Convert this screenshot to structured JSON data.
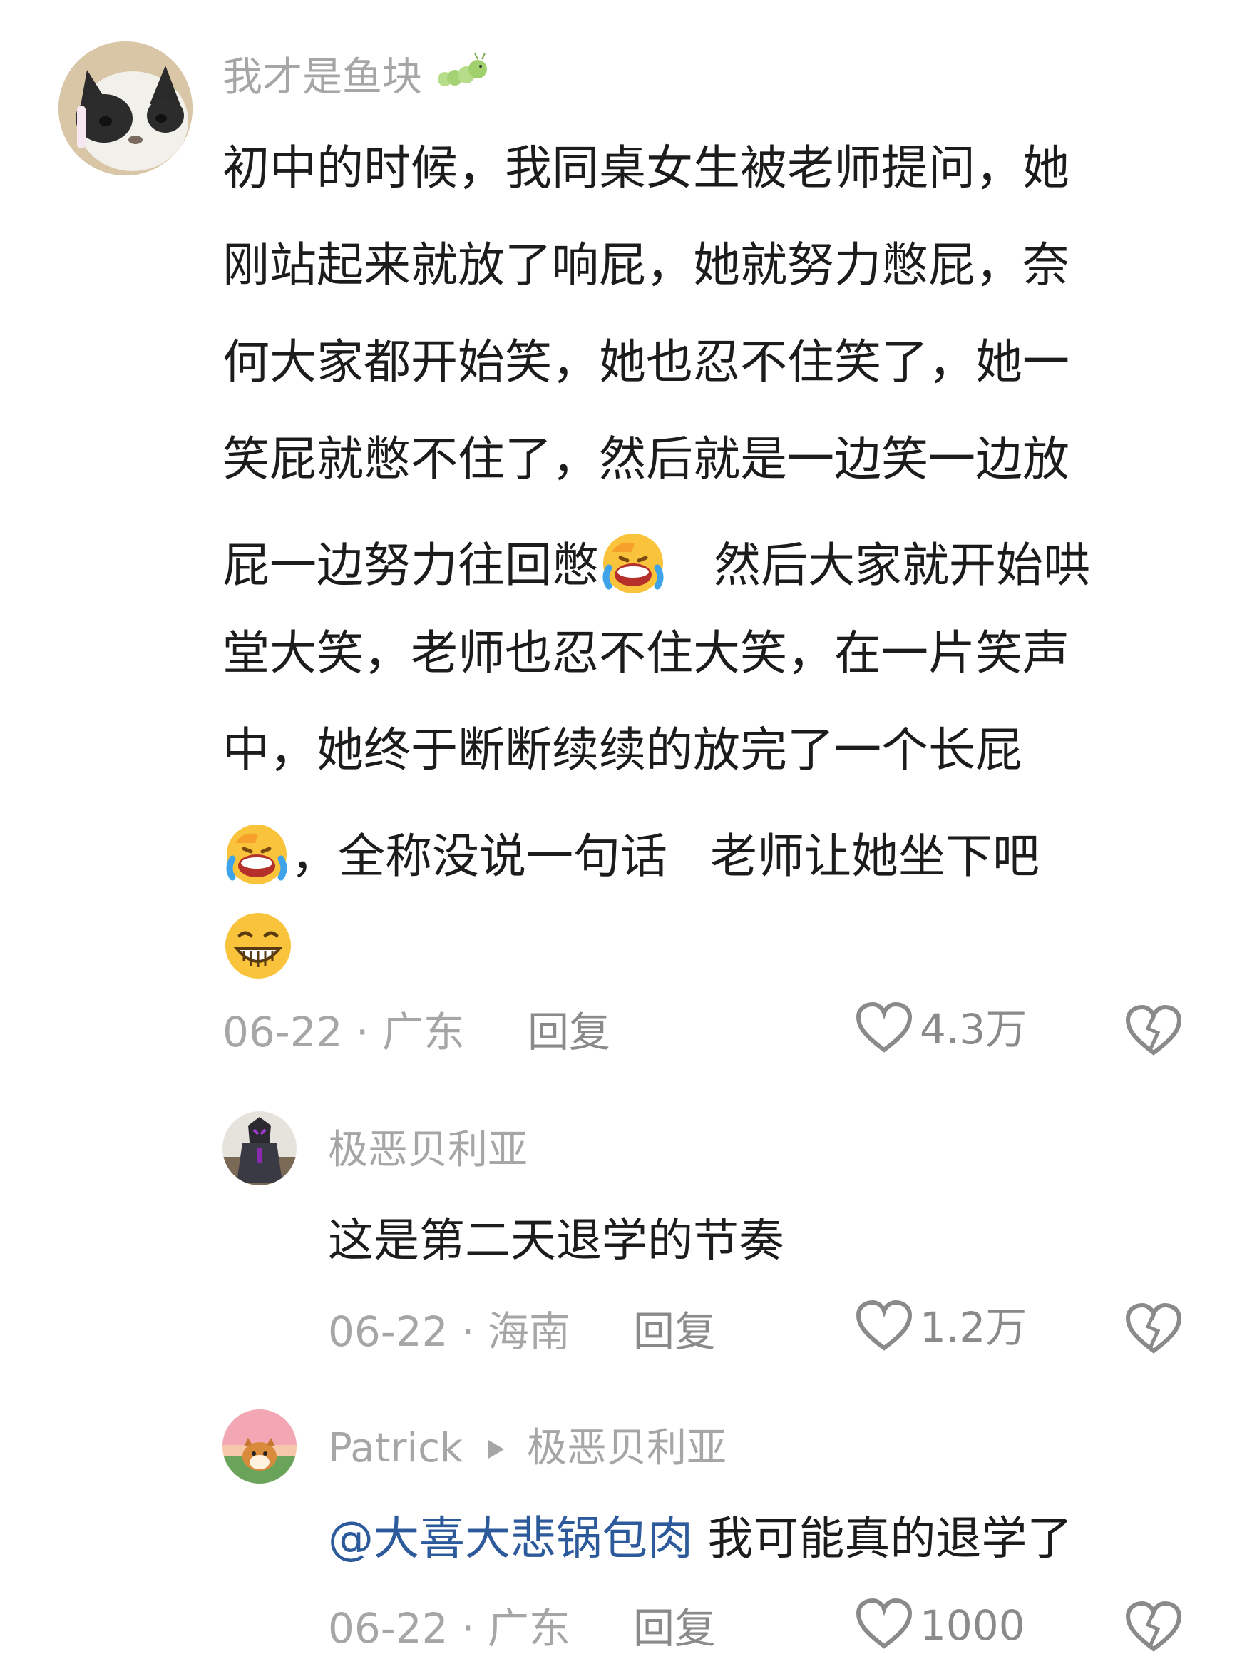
{
  "comment": {
    "username": "我才是鱼块",
    "username_icon": "caterpillar-emoji",
    "lines": [
      "初中的时候，我同桌女生被老师提问，她",
      "刚站起来就放了响屁，她就努力憋屁，奈",
      "何大家都开始笑，她也忍不住笑了，她一",
      "笑屁就憋不住了，然后就是一边笑一边放"
    ],
    "line5_a": "屁一边努力往回憋",
    "line5_b": "然后大家就开始哄",
    "line6": "堂大笑，老师也忍不住大笑，在一片笑声",
    "line7": "中，她终于断断续续的放完了一个长屁",
    "line8_a": "，全称没说一句话",
    "line8_b": "老师让她坐下吧",
    "emoji_1": "laughing-crying-emoji",
    "emoji_2": "grinning-emoji",
    "date": "06-22",
    "location": "广东",
    "reply_label": "回复",
    "likes": "4.3万"
  },
  "replies": [
    {
      "username": "极恶贝利亚",
      "text": "这是第二天退学的节奏",
      "date": "06-22",
      "location": "海南",
      "reply_label": "回复",
      "likes": "1.2万"
    },
    {
      "username": "Patrick",
      "reply_to": "极恶贝利亚",
      "mention": "@大喜大悲锅包肉",
      "text": "我可能真的退学了",
      "date": "06-22",
      "location": "广东",
      "reply_label": "回复",
      "likes": "1000"
    }
  ],
  "colors": {
    "text": "#1c1c1c",
    "meta": "#a6a6a6",
    "mention": "#2d5a9a"
  },
  "separator": "·"
}
